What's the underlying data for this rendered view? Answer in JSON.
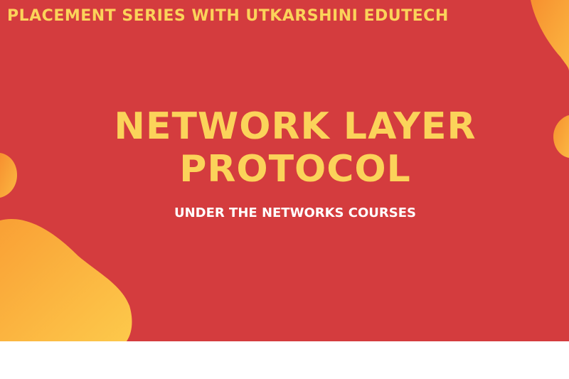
{
  "banner": {
    "series_title": "PLACEMENT SERIES WITH UTKARSHINI EDUTECH",
    "title_line_1": "NETWORK LAYER",
    "title_line_2": "PROTOCOL",
    "subtitle": "UNDER THE NETWORKS COURSES"
  },
  "colors": {
    "background": "#d43c3e",
    "title_yellow": "#fbd35a",
    "subtitle_white": "#ffffff",
    "blob_orange": "#f99a33",
    "blob_yellow": "#fcc64a",
    "page_white": "#ffffff"
  }
}
